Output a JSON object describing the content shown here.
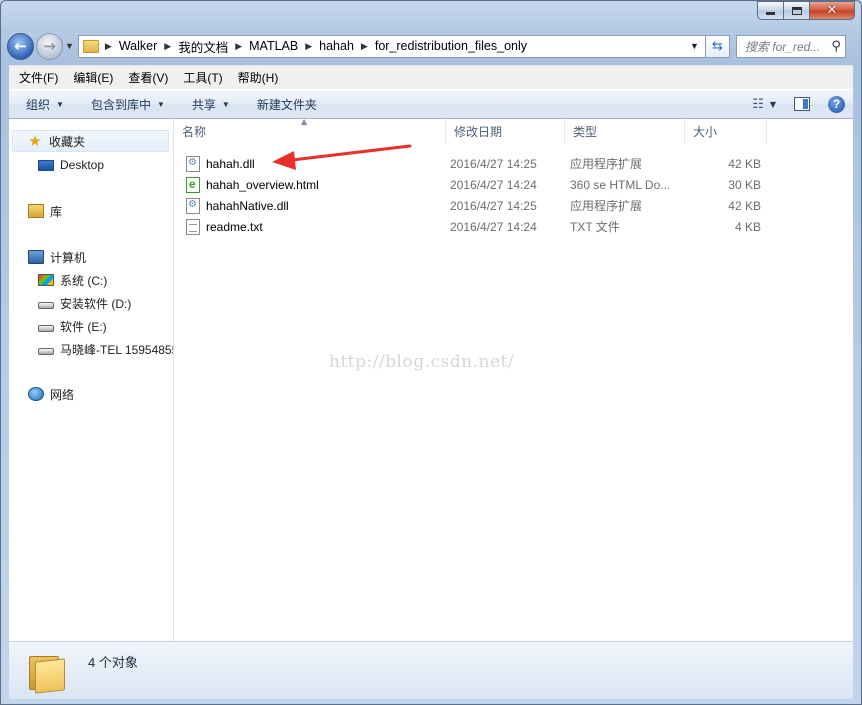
{
  "address": {
    "crumbs": [
      "Walker",
      "我的文档",
      "MATLAB",
      "hahah",
      "for_redistribution_files_only"
    ]
  },
  "search": {
    "placeholder": "搜索 for_red..."
  },
  "menu": [
    "文件(F)",
    "编辑(E)",
    "查看(V)",
    "工具(T)",
    "帮助(H)"
  ],
  "commands": {
    "organize": "组织",
    "include_in_library": "包含到库中",
    "share": "共享",
    "new_folder": "新建文件夹"
  },
  "nav": {
    "favorites": "收藏夹",
    "desktop": "Desktop",
    "libraries": "库",
    "computer": "计算机",
    "drives": [
      "系统 (C:)",
      "安装软件 (D:)",
      "软件 (E:)",
      "马晓峰-TEL 15954855"
    ],
    "network": "网络"
  },
  "columns": {
    "name": "名称",
    "date": "修改日期",
    "type": "类型",
    "size": "大小"
  },
  "files": [
    {
      "name": "hahah.dll",
      "date": "2016/4/27 14:25",
      "type": "应用程序扩展",
      "size": "42 KB",
      "icon": "dll-icon"
    },
    {
      "name": "hahah_overview.html",
      "date": "2016/4/27 14:24",
      "type": "360 se HTML Do...",
      "size": "30 KB",
      "icon": "html-icon"
    },
    {
      "name": "hahahNative.dll",
      "date": "2016/4/27 14:25",
      "type": "应用程序扩展",
      "size": "42 KB",
      "icon": "dll-icon"
    },
    {
      "name": "readme.txt",
      "date": "2016/4/27 14:24",
      "type": "TXT 文件",
      "size": "4 KB",
      "icon": "txt-icon"
    }
  ],
  "watermark": "http://blog.csdn.net/",
  "status": {
    "count": "4 个对象"
  },
  "colors": {
    "annotation_arrow": "#e8302a",
    "selection": "#e5eff9"
  }
}
